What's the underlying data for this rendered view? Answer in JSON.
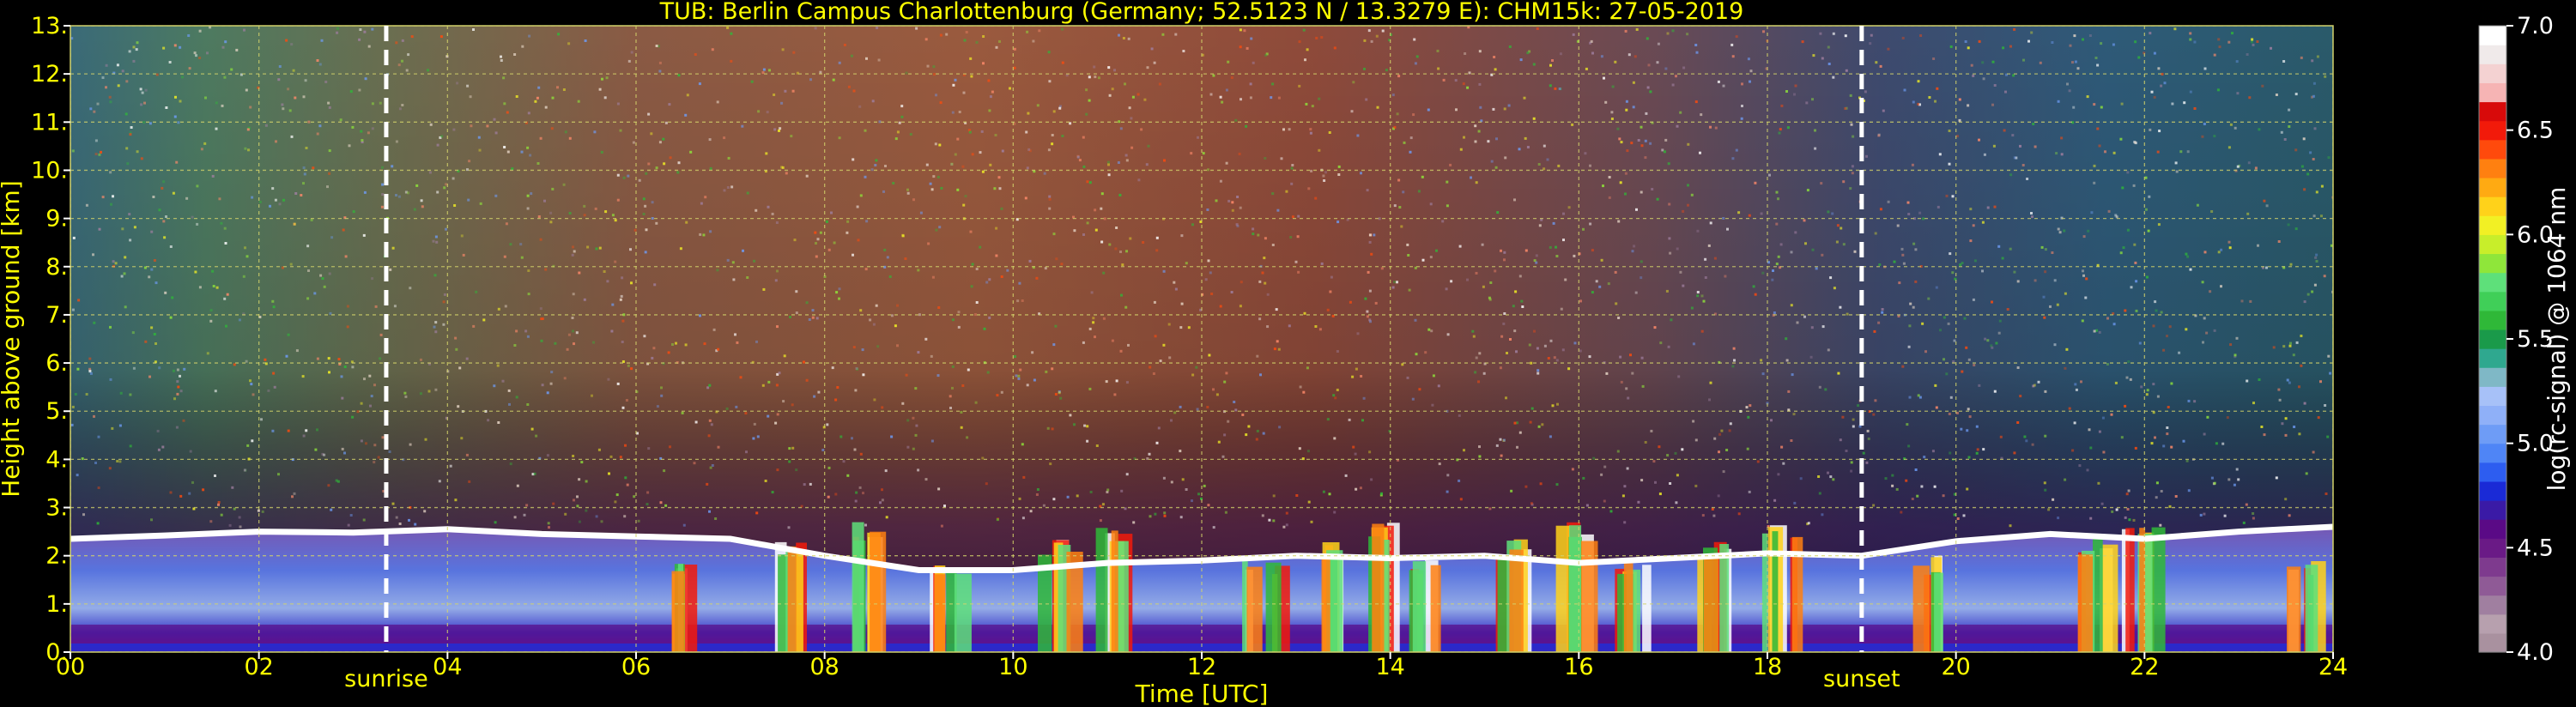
{
  "chart_data": {
    "type": "heatmap",
    "title": "TUB: Berlin Campus Charlottenburg (Germany; 52.5123 N / 13.3279 E):    CHM15k: 27-05-2019",
    "xlabel": "Time [UTC]",
    "ylabel": "Height above ground [km]",
    "xlim": [
      0,
      24
    ],
    "ylim": [
      0,
      13
    ],
    "x_ticks": [
      "00",
      "02",
      "04",
      "06",
      "08",
      "10",
      "12",
      "14",
      "16",
      "18",
      "20",
      "22",
      "24"
    ],
    "y_ticks": [
      "0.",
      "1.",
      "2.",
      "3.",
      "4.",
      "5.",
      "6.",
      "7.",
      "8.",
      "9.",
      "10.",
      "11.",
      "12.",
      "13."
    ],
    "grid": true,
    "markers": [
      {
        "label": "sunrise",
        "time_utc": 3.35
      },
      {
        "label": "sunset",
        "time_utc": 19.0
      }
    ],
    "colorbar": {
      "label": "log(rc-signal) @ 1064 nm",
      "range": [
        4.0,
        7.0
      ],
      "ticks": [
        "4.0",
        "4.5",
        "5.0",
        "5.5",
        "6.0",
        "6.5",
        "7.0"
      ],
      "colors": [
        "#a9919f",
        "#b7a0ae",
        "#a07fa0",
        "#8f5a96",
        "#7e3a8e",
        "#6a1a86",
        "#5a0a86",
        "#3a1aa6",
        "#1a2ad6",
        "#2d5df0",
        "#4f85f6",
        "#6e9cf6",
        "#8fb0f8",
        "#a7c1f8",
        "#7fb8c6",
        "#2fa88f",
        "#1a9a4a",
        "#2fb838",
        "#40cf58",
        "#5ee07a",
        "#8fe63a",
        "#c8ee2a",
        "#f2f024",
        "#ffd21a",
        "#ffaa12",
        "#ff8010",
        "#ff4a0c",
        "#f21a0a",
        "#d80a0a",
        "#f6b4b4",
        "#f4d2d2",
        "#f0eaea",
        "#ffffff"
      ]
    },
    "boundary_layer_top_km": [
      [
        0,
        2.35
      ],
      [
        1,
        2.42
      ],
      [
        2,
        2.5
      ],
      [
        3,
        2.48
      ],
      [
        4,
        2.55
      ],
      [
        5,
        2.45
      ],
      [
        6,
        2.4
      ],
      [
        7,
        2.35
      ],
      [
        8,
        2.0
      ],
      [
        9,
        1.7
      ],
      [
        10,
        1.7
      ],
      [
        11,
        1.85
      ],
      [
        12,
        1.9
      ],
      [
        13,
        2.0
      ],
      [
        14,
        1.95
      ],
      [
        15,
        2.0
      ],
      [
        16,
        1.85
      ],
      [
        17,
        1.95
      ],
      [
        18,
        2.05
      ],
      [
        19,
        2.0
      ],
      [
        20,
        2.3
      ],
      [
        21,
        2.45
      ],
      [
        22,
        2.35
      ],
      [
        23,
        2.5
      ],
      [
        24,
        2.6
      ]
    ],
    "cloud_events_time_utc": [
      6.4,
      7.6,
      8.4,
      9.2,
      10.4,
      11.0,
      12.6,
      13.3,
      13.9,
      14.3,
      15.3,
      15.9,
      16.5,
      17.4,
      18.1,
      19.6,
      21.4,
      21.9,
      23.6
    ]
  }
}
